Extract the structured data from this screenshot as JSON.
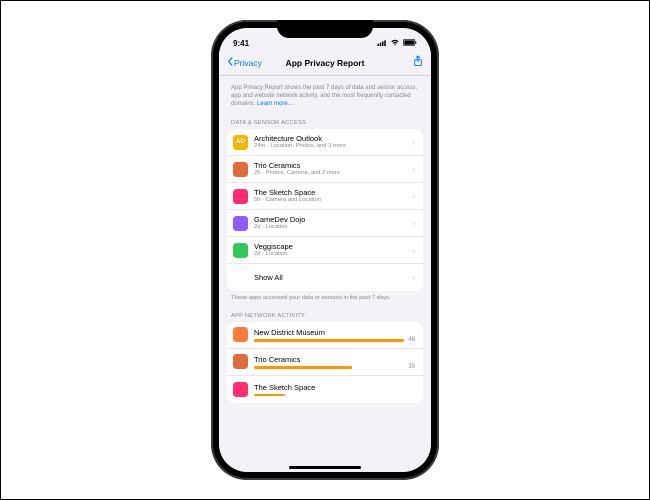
{
  "status": {
    "time": "9:41"
  },
  "nav": {
    "back_label": "Privacy",
    "title": "App Privacy Report"
  },
  "intro": {
    "text": "App Privacy Report shows the past 7 days of data and sensor access, app and website network activity, and the most frequently contacted domains.",
    "learn_more": "Learn more…"
  },
  "data_sensor": {
    "header": "DATA & SENSOR ACCESS",
    "items": [
      {
        "name": "Architecture Outlook",
        "sub": "24m · Location, Photos, and 3 more",
        "icon_bg": "#f5b400",
        "icon_txt": "AO"
      },
      {
        "name": "Trio Ceramics",
        "sub": "2h · Photos, Camera, and 2 more",
        "icon_bg": "#e06c3a",
        "icon_txt": ""
      },
      {
        "name": "The Sketch Space",
        "sub": "5h · Camera and Location",
        "icon_bg": "#ff2d70",
        "icon_txt": ""
      },
      {
        "name": "GameDev Dojo",
        "sub": "2d · Location",
        "icon_bg": "#8f5cff",
        "icon_txt": ""
      },
      {
        "name": "Veggiscape",
        "sub": "2d · Location",
        "icon_bg": "#34c759",
        "icon_txt": ""
      }
    ],
    "show_all": "Show All",
    "footer": "These apps accessed your data or sensors in the past 7 days."
  },
  "network": {
    "header": "APP NETWORK ACTIVITY",
    "items": [
      {
        "name": "New District Museum",
        "count": 46,
        "bar_pct": 100,
        "icon_bg": "#ff7b3d"
      },
      {
        "name": "Trio Ceramics",
        "count": 30,
        "bar_pct": 65,
        "icon_bg": "#e06c3a"
      },
      {
        "name": "The Sketch Space",
        "count": "",
        "bar_pct": 20,
        "icon_bg": "#ff2d70"
      }
    ]
  }
}
